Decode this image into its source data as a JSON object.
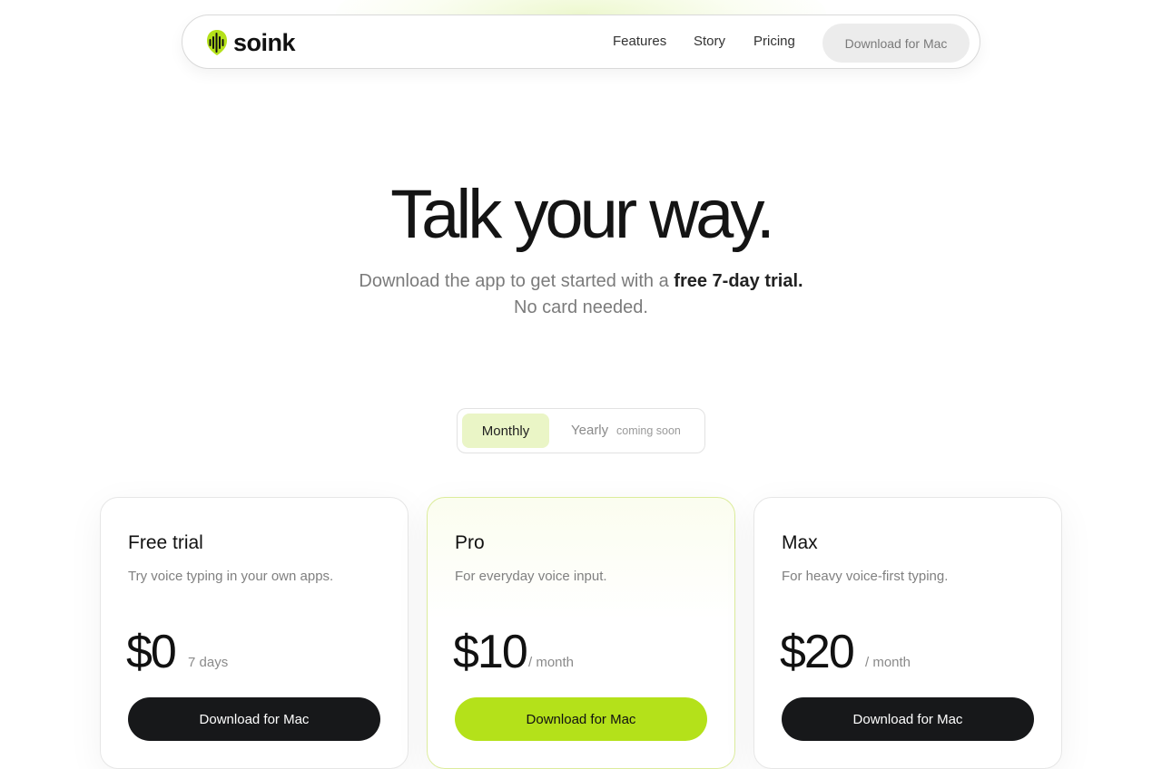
{
  "colors": {
    "accent": "#b4e11a",
    "accent_soft": "#eaf5c6",
    "dark_button": "#17181a",
    "text": "#111111",
    "muted": "#7b7b7b"
  },
  "nav": {
    "logo_text": "soink",
    "logo_icon": "soundwave-icon",
    "links": [
      "Features",
      "Story",
      "Pricing"
    ],
    "cta_label": "Download for Mac"
  },
  "hero": {
    "title": "Talk your way.",
    "subtitle_lead": "Download the app to get started with a ",
    "subtitle_strong": "free 7-day trial.",
    "subtitle_line2": "No card needed."
  },
  "billing_toggle": {
    "monthly_label": "Monthly",
    "yearly_label": "Yearly",
    "yearly_note": "coming soon",
    "selected": "Monthly"
  },
  "plans": [
    {
      "name": "Free trial",
      "description": "Try voice typing in your own apps.",
      "price": "$0",
      "period": "7 days",
      "button_label": "Download for Mac"
    },
    {
      "name": "Pro",
      "description": "For everyday voice input.",
      "price": "$10",
      "period": "/ month",
      "button_label": "Download for Mac"
    },
    {
      "name": "Max",
      "description": "For heavy voice-first typing.",
      "price": "$20",
      "period": "/ month",
      "button_label": "Download for Mac"
    }
  ]
}
